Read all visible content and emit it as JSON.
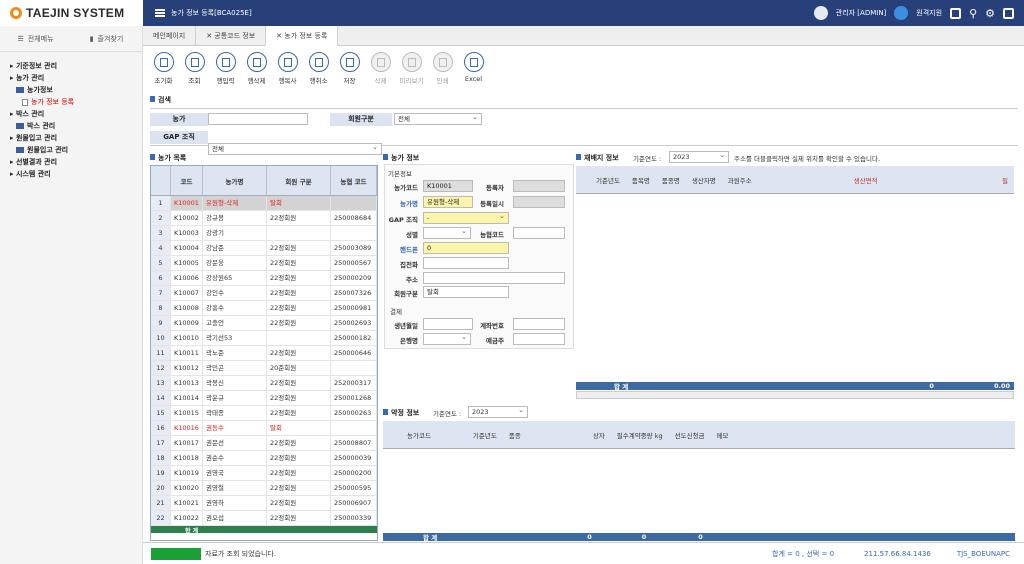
{
  "app": {
    "logo_text": "TAEJIN SYSTEM",
    "page_title": "농가 정보 등록[BCA025E]"
  },
  "topbar": {
    "user_label": "관리자 [ADMIN]",
    "remote_label": "원격지원"
  },
  "sidebar": {
    "tabs": [
      "전체메뉴",
      "즐겨찾기"
    ],
    "items": [
      {
        "label": "기준정보 관리",
        "level": 1
      },
      {
        "label": "농가 관리",
        "level": 1
      },
      {
        "label": "농가정보",
        "level": 2
      },
      {
        "label": "농가 정보 등록",
        "level": 3,
        "selected": true
      },
      {
        "label": "박스 관리",
        "level": 1
      },
      {
        "label": "박스 관리",
        "level": 2
      },
      {
        "label": "원물입고 관리",
        "level": 1
      },
      {
        "label": "원물입고 관리",
        "level": 2
      },
      {
        "label": "선별결과 관리",
        "level": 1
      },
      {
        "label": "시스템 관리",
        "level": 1
      }
    ]
  },
  "tabs": [
    "메인페이지",
    "공통코드 정보",
    "농가 정보 등록"
  ],
  "toolbar": [
    {
      "label": "초기화",
      "disabled": false
    },
    {
      "label": "조회",
      "disabled": false
    },
    {
      "label": "행입력",
      "disabled": false
    },
    {
      "label": "행삭제",
      "disabled": false
    },
    {
      "label": "행복사",
      "disabled": false
    },
    {
      "label": "행취소",
      "disabled": false
    },
    {
      "label": "저장",
      "disabled": false
    },
    {
      "label": "삭제",
      "disabled": true
    },
    {
      "label": "미리보기",
      "disabled": true
    },
    {
      "label": "인쇄",
      "disabled": true
    },
    {
      "label": "Excel",
      "disabled": false
    }
  ],
  "search": {
    "section": "검색",
    "farmer_label": "농가",
    "farmer_value": "",
    "member_label": "회원구분",
    "member_value": "전체",
    "gap_label": "GAP 조직",
    "gap_value": "전체"
  },
  "farm_grid": {
    "title": "농가 목록",
    "headers": [
      "코드",
      "농가명",
      "회원 구분",
      "농협 코드"
    ],
    "rows": [
      [
        "K10001",
        "유원형-삭제",
        "탈회",
        "",
        "red"
      ],
      [
        "K10002",
        "강규봉",
        "22정회원",
        "250008684",
        ""
      ],
      [
        "K10003",
        "강광기",
        "",
        "",
        ""
      ],
      [
        "K10004",
        "강남준",
        "22정회원",
        "250003089",
        ""
      ],
      [
        "K10005",
        "강문웅",
        "22정회원",
        "250000567",
        ""
      ],
      [
        "K10006",
        "강상원65",
        "22정회원",
        "250000209",
        ""
      ],
      [
        "K10007",
        "강인수",
        "22정회원",
        "250007326",
        ""
      ],
      [
        "K10008",
        "강흥수",
        "22정회원",
        "250000981",
        ""
      ],
      [
        "K10009",
        "고충언",
        "22정회원",
        "250002693",
        ""
      ],
      [
        "K10010",
        "곽기선53",
        "",
        "250000182",
        ""
      ],
      [
        "K10011",
        "곽노준",
        "22정회원",
        "250000646",
        ""
      ],
      [
        "K10012",
        "곽민곤",
        "20준회원",
        "",
        ""
      ],
      [
        "K10013",
        "곽봉신",
        "22정회원",
        "252000317",
        ""
      ],
      [
        "K10014",
        "곽운규",
        "22정회원",
        "250001268",
        ""
      ],
      [
        "K10015",
        "곽태종",
        "22정회원",
        "250000263",
        ""
      ],
      [
        "K10016",
        "권동수",
        "탈회",
        "",
        "red"
      ],
      [
        "K10017",
        "권문선",
        "22정회원",
        "250008807",
        ""
      ],
      [
        "K10018",
        "권순수",
        "22정회원",
        "250000039",
        ""
      ],
      [
        "K10019",
        "권영국",
        "22정회원",
        "250000200",
        ""
      ],
      [
        "K10020",
        "권영철",
        "22정회원",
        "250000595",
        ""
      ],
      [
        "K10021",
        "권영하",
        "22정회원",
        "250006907",
        ""
      ],
      [
        "K10022",
        "권오섭",
        "22정회원",
        "250000339",
        ""
      ]
    ],
    "sum_label": "합 계"
  },
  "farm_info": {
    "title": "농가 정보",
    "basic_label": "기본정보",
    "code_label": "농가코드",
    "code_value": "K10001",
    "reg_user_label": "등록자",
    "reg_user_value": "",
    "name_label": "농가명",
    "name_value": "유원형-삭제",
    "reg_date_label": "등록일시",
    "reg_date_value": "",
    "gap_label": "GAP 조직",
    "gap_value": "-",
    "gender_label": "성별",
    "gender_value": "",
    "nh_code_label": "농협코드",
    "nh_code_value": "",
    "phone_label": "핸드폰",
    "phone_value": "0",
    "home_label": "집전화",
    "home_value": "",
    "addr_label": "주소",
    "addr_value": "",
    "member_label": "회원구분",
    "member_value": "탈회",
    "pay_label": "결제",
    "birth_label": "생년월일",
    "birth_value": "",
    "account_label": "계좌번호",
    "account_value": "",
    "bank_label": "은행명",
    "bank_value": "",
    "holder_label": "예금주",
    "holder_value": ""
  },
  "pay_grid": {
    "title": "재배지 정보",
    "year_label": "기준연도 :",
    "year_value": "2023",
    "hint": "주소를 더블클릭하면 실제 위치를 확인할 수 있습니다.",
    "headers": [
      "기준년도",
      "품목명",
      "품종명",
      "생산자명",
      "과원주소",
      "생산면적",
      "필"
    ],
    "sum_label": "합 계",
    "sum_value1": "0",
    "sum_value2": "0.00"
  },
  "contract_grid": {
    "title": "약정 정보",
    "year_label": "기준연도 :",
    "year_value": "2023",
    "headers": [
      "농가코드",
      "기준년도",
      "품종",
      "상자",
      "필수계약중량 kg",
      "선도신청금",
      "메모"
    ],
    "sum_label": "합 계",
    "sums": [
      "0",
      "0",
      "0"
    ]
  },
  "status": {
    "message": "자료가 조회 되었습니다.",
    "counts": "합계 = 0 , 선택 = 0",
    "ip": "211.57.66.84.1436",
    "host": "TJS_BOEUNAPC"
  }
}
